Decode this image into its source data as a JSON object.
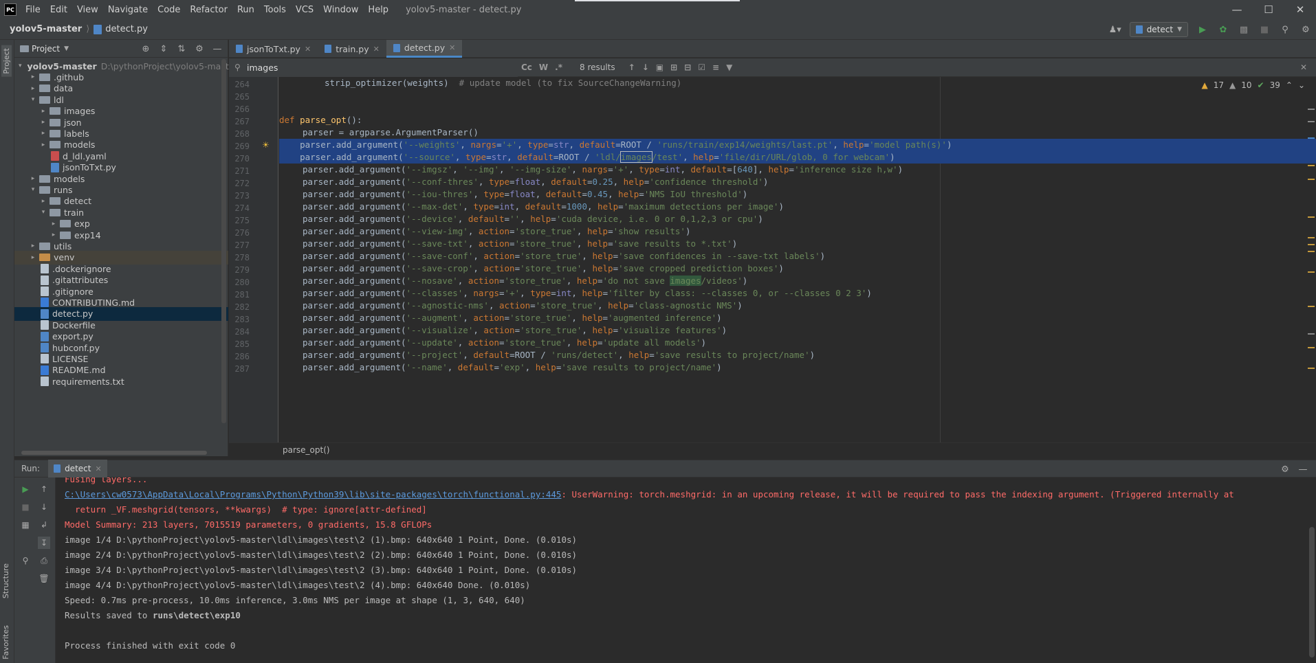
{
  "titlebar": {
    "logo": "PC",
    "menu": [
      "File",
      "Edit",
      "View",
      "Navigate",
      "Code",
      "Refactor",
      "Run",
      "Tools",
      "VCS",
      "Window",
      "Help"
    ],
    "window_title": "yolov5-master - detect.py"
  },
  "navbar": {
    "project": "yolov5-master",
    "file": "detect.py",
    "run_config": "detect"
  },
  "left_strip": {
    "project_tab": "Project",
    "structure_tab": "Structure",
    "favorites_tab": "Favorites"
  },
  "project_panel": {
    "title": "Project",
    "tree": [
      {
        "label": "yolov5-master",
        "path": "D:\\pythonProject\\yolov5-mast",
        "level": 0,
        "kind": "folder",
        "open": true
      },
      {
        "label": ".github",
        "level": 1,
        "kind": "folder",
        "open": false
      },
      {
        "label": "data",
        "level": 1,
        "kind": "folder",
        "open": false
      },
      {
        "label": "ldl",
        "level": 1,
        "kind": "folder",
        "open": true
      },
      {
        "label": "images",
        "level": 2,
        "kind": "folder",
        "open": false
      },
      {
        "label": "json",
        "level": 2,
        "kind": "folder",
        "open": false
      },
      {
        "label": "labels",
        "level": 2,
        "kind": "folder",
        "open": false
      },
      {
        "label": "models",
        "level": 2,
        "kind": "folder",
        "open": false
      },
      {
        "label": "d_ldl.yaml",
        "level": 2,
        "kind": "yml"
      },
      {
        "label": "jsonToTxt.py",
        "level": 2,
        "kind": "py"
      },
      {
        "label": "models",
        "level": 1,
        "kind": "folder",
        "open": false
      },
      {
        "label": "runs",
        "level": 1,
        "kind": "folder",
        "open": true
      },
      {
        "label": "detect",
        "level": 2,
        "kind": "folder",
        "open": false
      },
      {
        "label": "train",
        "level": 2,
        "kind": "folder",
        "open": true
      },
      {
        "label": "exp",
        "level": 3,
        "kind": "folder",
        "open": false
      },
      {
        "label": "exp14",
        "level": 3,
        "kind": "folder",
        "open": false
      },
      {
        "label": "utils",
        "level": 1,
        "kind": "folder",
        "open": false
      },
      {
        "label": "venv",
        "level": 1,
        "kind": "folder-orange",
        "open": false
      },
      {
        "label": ".dockerignore",
        "level": 1,
        "kind": "file"
      },
      {
        "label": ".gitattributes",
        "level": 1,
        "kind": "file"
      },
      {
        "label": ".gitignore",
        "level": 1,
        "kind": "file"
      },
      {
        "label": "CONTRIBUTING.md",
        "level": 1,
        "kind": "md"
      },
      {
        "label": "detect.py",
        "level": 1,
        "kind": "py"
      },
      {
        "label": "Dockerfile",
        "level": 1,
        "kind": "file"
      },
      {
        "label": "export.py",
        "level": 1,
        "kind": "py"
      },
      {
        "label": "hubconf.py",
        "level": 1,
        "kind": "py"
      },
      {
        "label": "LICENSE",
        "level": 1,
        "kind": "file"
      },
      {
        "label": "README.md",
        "level": 1,
        "kind": "md"
      },
      {
        "label": "requirements.txt",
        "level": 1,
        "kind": "file"
      }
    ]
  },
  "editor": {
    "tabs": [
      {
        "label": "jsonToTxt.py",
        "active": false
      },
      {
        "label": "train.py",
        "active": false
      },
      {
        "label": "detect.py",
        "active": true
      }
    ],
    "find": {
      "query": "images",
      "results": "8 results",
      "case": "Cc",
      "word": "W",
      "regex": ".*"
    },
    "inspections": {
      "warnings": "17",
      "weak": "10",
      "ok": "39"
    },
    "line_numbers": [
      "264",
      "265",
      "266",
      "267",
      "268",
      "269",
      "270",
      "271",
      "272",
      "273",
      "274",
      "275",
      "276",
      "277",
      "278",
      "279",
      "280",
      "281",
      "282",
      "283",
      "284",
      "285",
      "286",
      "287"
    ],
    "breadcrumb": "parse_opt()"
  },
  "run": {
    "label": "Run:",
    "tab": "detect",
    "console": [
      "Fusing layers...",
      "C:\\Users\\cw0573\\AppData\\Local\\Programs\\Python\\Python39\\lib\\site-packages\\torch\\functional.py:445",
      ": UserWarning: torch.meshgrid: in an upcoming release, it will be required to pass the indexing argument. (Triggered internally at",
      "  return _VF.meshgrid(tensors, **kwargs)  # type: ignore[attr-defined]",
      "Model Summary: 213 layers, 7015519 parameters, 0 gradients, 15.8 GFLOPs",
      "image 1/4 D:\\pythonProject\\yolov5-master\\ldl\\images\\test\\2 (1).bmp: 640x640 1 Point, Done. (0.010s)",
      "image 2/4 D:\\pythonProject\\yolov5-master\\ldl\\images\\test\\2 (2).bmp: 640x640 1 Point, Done. (0.010s)",
      "image 3/4 D:\\pythonProject\\yolov5-master\\ldl\\images\\test\\2 (3).bmp: 640x640 1 Point, Done. (0.010s)",
      "image 4/4 D:\\pythonProject\\yolov5-master\\ldl\\images\\test\\2 (4).bmp: 640x640 Done. (0.010s)",
      "Speed: 0.7ms pre-process, 10.0ms inference, 3.0ms NMS per image at shape (1, 3, 640, 640)",
      "Results saved to ",
      "runs\\detect\\exp10",
      "Process finished with exit code 0"
    ]
  },
  "colors": {
    "accent": "#4a88c7",
    "selection": "#214283",
    "error": "#ff6b68",
    "link": "#5d9bde",
    "string": "#6a8759",
    "keyword": "#cc7832"
  }
}
